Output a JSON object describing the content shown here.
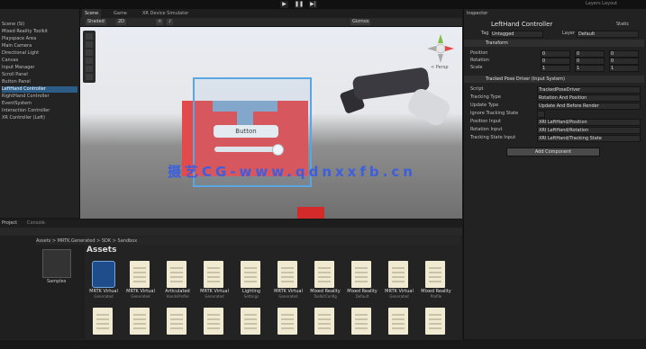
{
  "topbar": {
    "left_text": "",
    "right_text": "Layers   Layout",
    "play": "▶",
    "pause": "❚❚",
    "step": "▶|"
  },
  "hierarchy": {
    "items": [
      {
        "label": "Scene (Sl)"
      },
      {
        "label": "Mixed Reality Toolkit"
      },
      {
        "label": "Playspace Area"
      },
      {
        "label": "Main Camera"
      },
      {
        "label": "Directional Light"
      },
      {
        "label": "Canvas"
      },
      {
        "label": "Input Manager"
      },
      {
        "label": "Scroll Panel"
      },
      {
        "label": "Button Panel"
      },
      {
        "label": "LeftHand Controller",
        "selected": true
      },
      {
        "label": "RightHand Controller"
      },
      {
        "label": "EventSystem"
      },
      {
        "label": "Interaction Controller"
      },
      {
        "label": "XR Controller (Left)"
      }
    ]
  },
  "scene": {
    "tabs": [
      "Scene",
      "Game",
      "XR Device Simulator"
    ],
    "toolbar": [
      "Shaded",
      "2D",
      "☼",
      "♪",
      "Gizmos"
    ],
    "button_text": "Button",
    "persp": "< Persp"
  },
  "watermark": "摄艺CG-www.qdnxxfb.cn",
  "inspector": {
    "tab": "Inspector",
    "object_name": "LeftHand Controller",
    "static": "Static",
    "tag_label": "Tag",
    "tag": "Untagged",
    "layer_label": "Layer",
    "layer": "Default",
    "transform": {
      "title": "Transform",
      "rows": [
        {
          "label": "Position",
          "x": "0",
          "y": "0",
          "z": "0"
        },
        {
          "label": "Rotation",
          "x": "0",
          "y": "0",
          "z": "0"
        },
        {
          "label": "Scale",
          "x": "1",
          "y": "1",
          "z": "1"
        }
      ]
    },
    "component": {
      "title": "Tracked Pose Driver (Input System)",
      "rows": [
        {
          "label": "Script",
          "value": "TrackedPoseDriver"
        },
        {
          "label": "Tracking Type",
          "value": "Rotation And Position"
        },
        {
          "label": "Update Type",
          "value": "Update And Before Render"
        },
        {
          "label": "Ignore Tracking State",
          "value": ""
        },
        {
          "label": "Position Input",
          "value": "XRI LeftHand/Position"
        },
        {
          "label": "Rotation Input",
          "value": "XRI LeftHand/Rotation"
        },
        {
          "label": "Tracking State Input",
          "value": "XRI LeftHand/Tracking State"
        }
      ]
    },
    "add_component": "Add Component"
  },
  "project": {
    "tabs": [
      "Project",
      "Console"
    ],
    "breadcrumb": "Assets > MRTK.Generated > SDK > Sandbox",
    "assets_title": "Assets",
    "package_label": "Samples",
    "assets": [
      {
        "label": "MRTK Virtual",
        "sub": "Generated",
        "kind": "logo"
      },
      {
        "label": "MRTK Virtual",
        "sub": "Generated",
        "kind": "doc"
      },
      {
        "label": "Articulated",
        "sub": "HandsProfile",
        "kind": "doc"
      },
      {
        "label": "MRTK Virtual",
        "sub": "Generated",
        "kind": "doc"
      },
      {
        "label": "Lighting",
        "sub": "Settings",
        "kind": "doc"
      },
      {
        "label": "MRTK Virtual",
        "sub": "Generated",
        "kind": "doc"
      },
      {
        "label": "Mixed Reality",
        "sub": "ToolkitConfig",
        "kind": "doc"
      },
      {
        "label": "Mixed Reality",
        "sub": "Default",
        "kind": "doc"
      },
      {
        "label": "MRTK Virtual",
        "sub": "Generated",
        "kind": "doc"
      },
      {
        "label": "Mixed Reality",
        "sub": "Profile",
        "kind": "doc"
      },
      {
        "label": "",
        "sub": "",
        "kind": "doc"
      },
      {
        "label": "",
        "sub": "",
        "kind": "doc"
      },
      {
        "label": "",
        "sub": "",
        "kind": "doc"
      },
      {
        "label": "",
        "sub": "",
        "kind": "doc"
      },
      {
        "label": "",
        "sub": "",
        "kind": "doc"
      },
      {
        "label": "",
        "sub": "",
        "kind": "doc"
      },
      {
        "label": "",
        "sub": "",
        "kind": "doc"
      },
      {
        "label": "",
        "sub": "",
        "kind": "doc"
      },
      {
        "label": "",
        "sub": "",
        "kind": "doc"
      },
      {
        "label": "",
        "sub": "",
        "kind": "doc"
      }
    ]
  }
}
